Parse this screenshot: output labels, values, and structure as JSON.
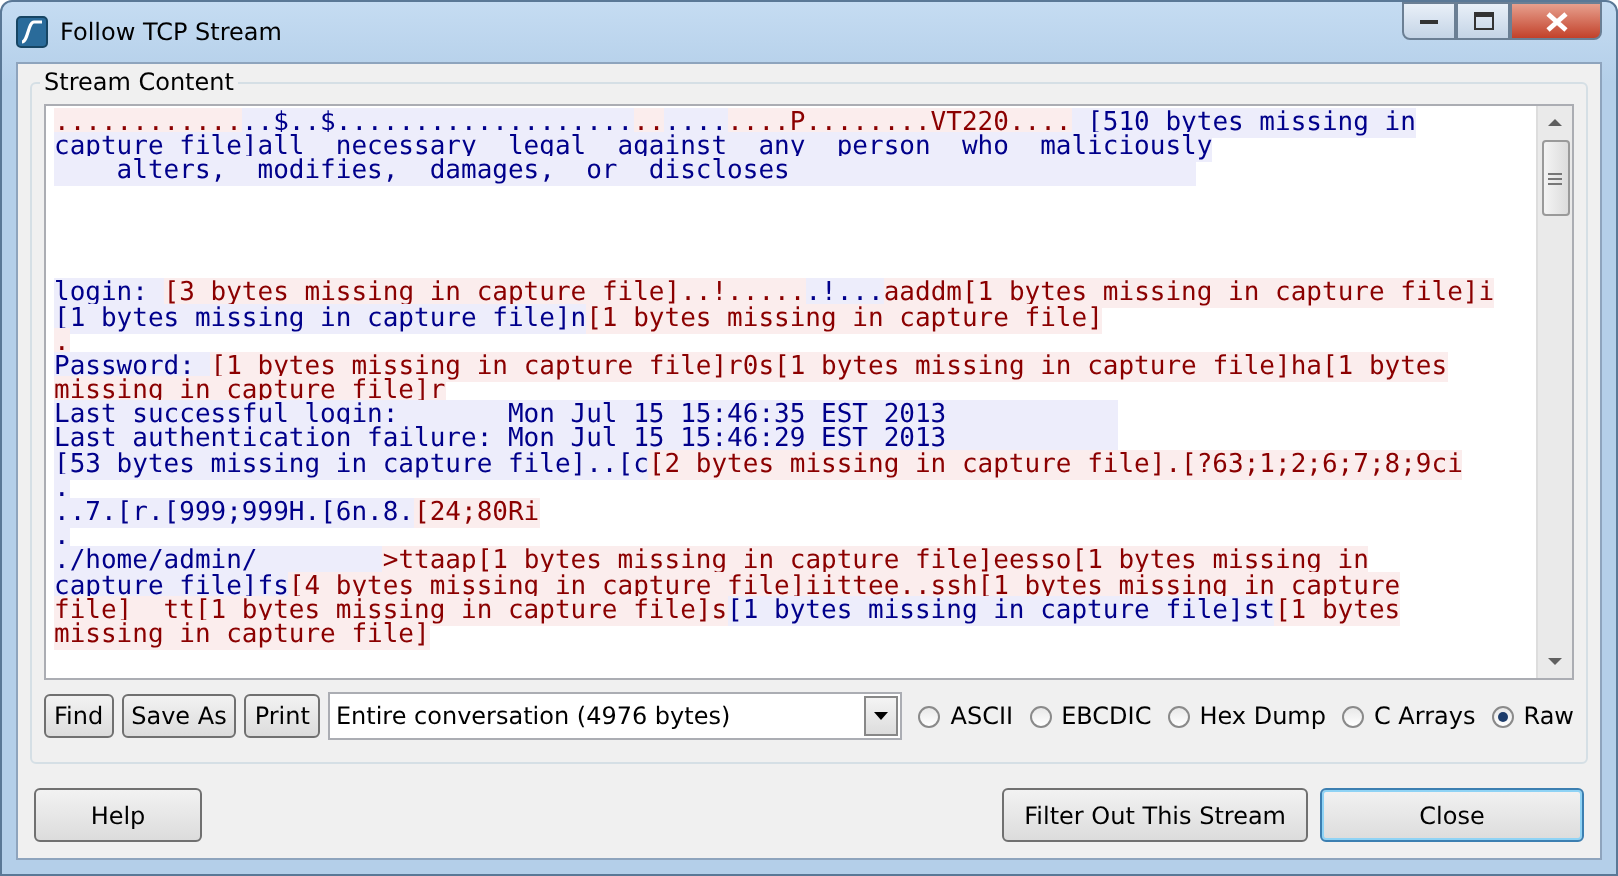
{
  "window": {
    "title": "Follow TCP Stream"
  },
  "stream": {
    "label": "Stream Content",
    "lines": [
      {
        "kind": "text",
        "segments": [
          {
            "kind": "client",
            "text": "............"
          },
          {
            "kind": "server",
            "text": "..$..$..................."
          },
          {
            "kind": "client",
            "text": ".."
          },
          {
            "kind": "server",
            "text": "...."
          },
          {
            "kind": "client",
            "text": "....P........VT220...."
          },
          {
            "kind": "server",
            "text": " [510 bytes missing in"
          }
        ]
      },
      {
        "kind": "text",
        "segments": [
          {
            "kind": "server",
            "text": "capture file]all  necessary  legal  against  any  person  who  maliciously"
          }
        ]
      },
      {
        "kind": "text",
        "segments": [
          {
            "kind": "server",
            "text": "    alters,  modifies,  damages,  or  discloses                          "
          }
        ]
      },
      {
        "kind": "blank"
      },
      {
        "kind": "blank"
      },
      {
        "kind": "blank"
      },
      {
        "kind": "blank"
      },
      {
        "kind": "text",
        "segments": [
          {
            "kind": "server",
            "text": "login: "
          },
          {
            "kind": "client",
            "text": "[3 bytes missing in capture file]..!....."
          },
          {
            "kind": "server",
            "text": ".!..."
          },
          {
            "kind": "client",
            "text": "aaddm[1 bytes missing in capture file]i"
          }
        ]
      },
      {
        "kind": "text",
        "segments": [
          {
            "kind": "server",
            "text": "[1 bytes missing in capture file]n"
          },
          {
            "kind": "client",
            "text": "[1 bytes missing in capture file]"
          }
        ]
      },
      {
        "kind": "text",
        "segments": [
          {
            "kind": "client",
            "text": "."
          }
        ]
      },
      {
        "kind": "text",
        "segments": [
          {
            "kind": "server",
            "text": "Password: "
          },
          {
            "kind": "client",
            "text": "[1 bytes missing in capture file]r0s[1 bytes missing in capture file]ha[1 bytes"
          }
        ]
      },
      {
        "kind": "text",
        "segments": [
          {
            "kind": "client",
            "text": "missing in capture file]r"
          }
        ]
      },
      {
        "kind": "text",
        "segments": [
          {
            "kind": "server",
            "text": "Last successful login:       Mon Jul 15 15:46:35 EST 2013           "
          }
        ]
      },
      {
        "kind": "text",
        "segments": [
          {
            "kind": "server",
            "text": "Last authentication failure: Mon Jul 15 15:46:29 EST 2013           "
          }
        ]
      },
      {
        "kind": "text",
        "segments": [
          {
            "kind": "server",
            "text": "[53 bytes missing in capture file]..[c"
          },
          {
            "kind": "client",
            "text": "[2 bytes missing in capture file].[?63;1;2;6;7;8;9ci"
          }
        ]
      },
      {
        "kind": "text",
        "segments": [
          {
            "kind": "server",
            "text": "."
          }
        ]
      },
      {
        "kind": "text",
        "segments": [
          {
            "kind": "server",
            "text": "..7.[r.[999;999H.[6n.8."
          },
          {
            "kind": "client",
            "text": "[24;80Ri"
          }
        ]
      },
      {
        "kind": "text",
        "segments": [
          {
            "kind": "server",
            "text": "."
          }
        ]
      },
      {
        "kind": "text",
        "segments": [
          {
            "kind": "server",
            "text": "./home/admin/        "
          },
          {
            "kind": "client",
            "text": ">ttaap[1 bytes missing in capture file]eesso[1 bytes missing in"
          }
        ]
      },
      {
        "kind": "text",
        "segments": [
          {
            "kind": "server",
            "text": "capture file]fs"
          },
          {
            "kind": "client",
            "text": "[4 bytes missing in capture file]iittee..ssh[1 bytes missing in capture"
          }
        ]
      },
      {
        "kind": "text",
        "segments": [
          {
            "kind": "client",
            "text": "file]  tt[1 bytes missing in capture file]s"
          },
          {
            "kind": "server",
            "text": "[1 bytes missing in capture file]st"
          },
          {
            "kind": "client",
            "text": "[1 bytes"
          }
        ]
      },
      {
        "kind": "text",
        "segments": [
          {
            "kind": "client",
            "text": "missing in capture file]"
          }
        ]
      }
    ]
  },
  "toolbar": {
    "buttons": [
      "Find",
      "Save As",
      "Print"
    ],
    "conversation": {
      "value": "Entire conversation (4976 bytes)"
    },
    "formats": [
      {
        "label": "ASCII",
        "selected": false
      },
      {
        "label": "EBCDIC",
        "selected": false
      },
      {
        "label": "Hex Dump",
        "selected": false
      },
      {
        "label": "C Arrays",
        "selected": false
      },
      {
        "label": "Raw",
        "selected": true
      }
    ]
  },
  "buttons": [
    {
      "label": "Help",
      "default": false
    },
    {
      "label": "Filter Out This Stream",
      "default": false
    },
    {
      "label": "Close",
      "default": true
    }
  ]
}
